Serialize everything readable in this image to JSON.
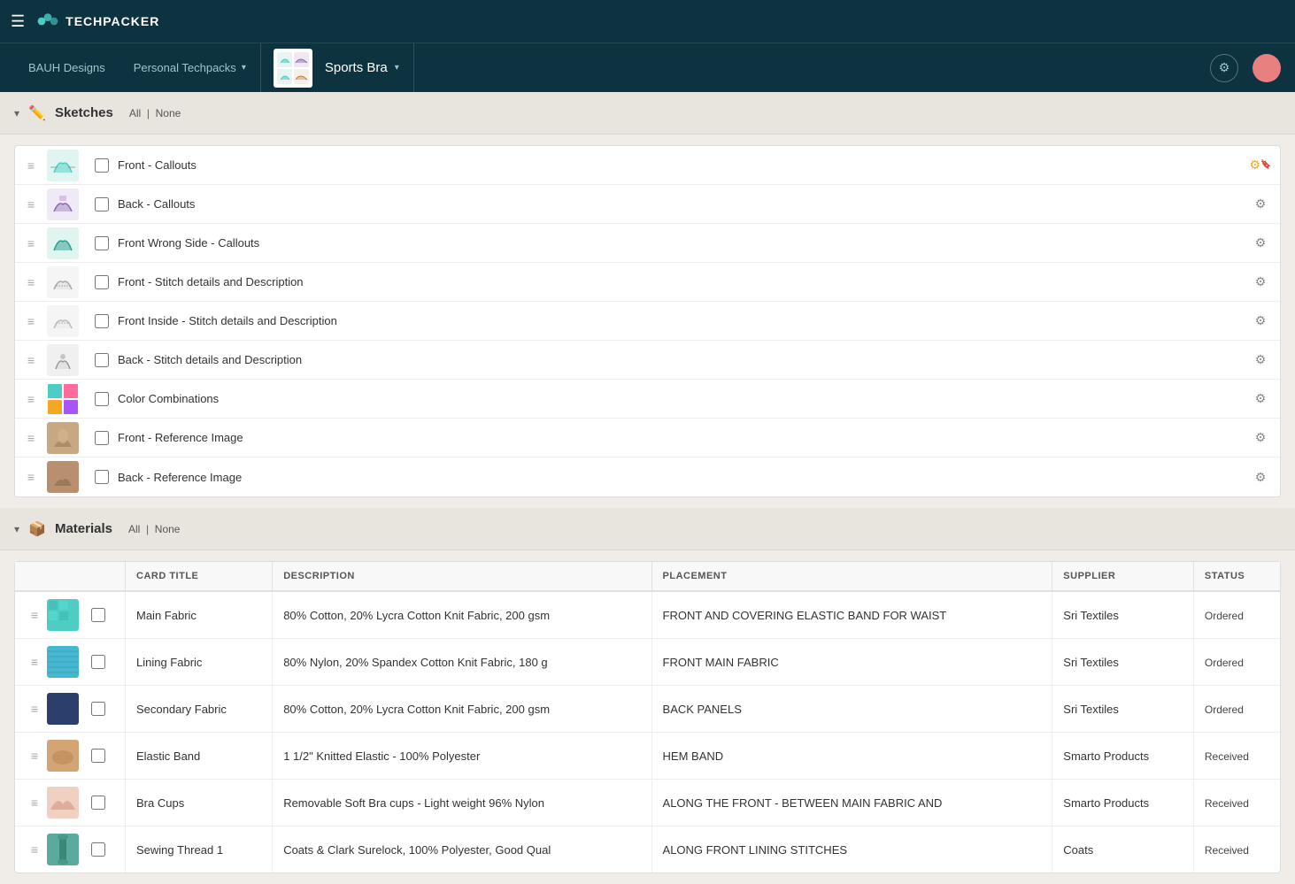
{
  "app": {
    "name": "TECHPACKER",
    "hamburger_label": "☰"
  },
  "header": {
    "breadcrumb_brand": "BAUH Designs",
    "breadcrumb_collection": "Personal Techpacks",
    "product_name": "Sports Bra",
    "gear_icon": "⚙",
    "chevron": "▾"
  },
  "sketches_section": {
    "title": "Sketches",
    "all_label": "All",
    "none_label": "None",
    "items": [
      {
        "label": "Front - Callouts",
        "swatch": "teal",
        "has_gear_highlight": true
      },
      {
        "label": "Back - Callouts",
        "swatch": "multi",
        "has_gear_highlight": false
      },
      {
        "label": "Front Wrong Side - Callouts",
        "swatch": "teal",
        "has_gear_highlight": false
      },
      {
        "label": "Front - Stitch details and Description",
        "swatch": "gray",
        "has_gear_highlight": false
      },
      {
        "label": "Front Inside - Stitch details and Description",
        "swatch": "gray2",
        "has_gear_highlight": false
      },
      {
        "label": "Back - Stitch details and Description",
        "swatch": "back-stitch",
        "has_gear_highlight": false
      },
      {
        "label": "Color Combinations",
        "swatch": "color-combo",
        "has_gear_highlight": false
      },
      {
        "label": "Front - Reference Image",
        "swatch": "ref-front",
        "has_gear_highlight": false
      },
      {
        "label": "Back - Reference Image",
        "swatch": "ref-back",
        "has_gear_highlight": false
      }
    ]
  },
  "materials_section": {
    "title": "Materials",
    "all_label": "All",
    "none_label": "None",
    "columns": [
      "Card Title",
      "DESCRIPTION",
      "PLACEMENT",
      "SUPPLIER",
      "STATUS"
    ],
    "items": [
      {
        "title": "Main Fabric",
        "description": "80% Cotton, 20% Lycra Cotton Knit Fabric, 200 gsm",
        "placement": "FRONT AND COVERING ELASTIC BAND FOR WAIST",
        "supplier": "Sri Textiles",
        "status": "Ordered",
        "swatch": "teal"
      },
      {
        "title": "Lining Fabric",
        "description": "80% Nylon, 20% Spandex Cotton Knit Fabric, 180 g",
        "placement": "FRONT MAIN FABRIC",
        "supplier": "Sri Textiles",
        "status": "Ordered",
        "swatch": "teal2"
      },
      {
        "title": "Secondary Fabric",
        "description": "80% Cotton, 20% Lycra Cotton Knit Fabric, 200 gsm",
        "placement": "BACK PANELS",
        "supplier": "Sri Textiles",
        "status": "Ordered",
        "swatch": "navy"
      },
      {
        "title": "Elastic Band",
        "description": "1 1/2\" Knitted Elastic - 100% Polyester",
        "placement": "HEM BAND",
        "supplier": "Smarto Products",
        "status": "Received",
        "swatch": "skin"
      },
      {
        "title": "Bra Cups",
        "description": "Removable Soft Bra cups - Light weight 96% Nylon",
        "placement": "ALONG THE FRONT - BETWEEN MAIN FABRIC AND",
        "supplier": "Smarto Products",
        "status": "Received",
        "swatch": "pink"
      },
      {
        "title": "Sewing Thread 1",
        "description": "Coats & Clark Surelock, 100% Polyester, Good Qual",
        "placement": "ALONG FRONT LINING STITCHES",
        "supplier": "Coats",
        "status": "Received",
        "swatch": "thread"
      }
    ]
  }
}
